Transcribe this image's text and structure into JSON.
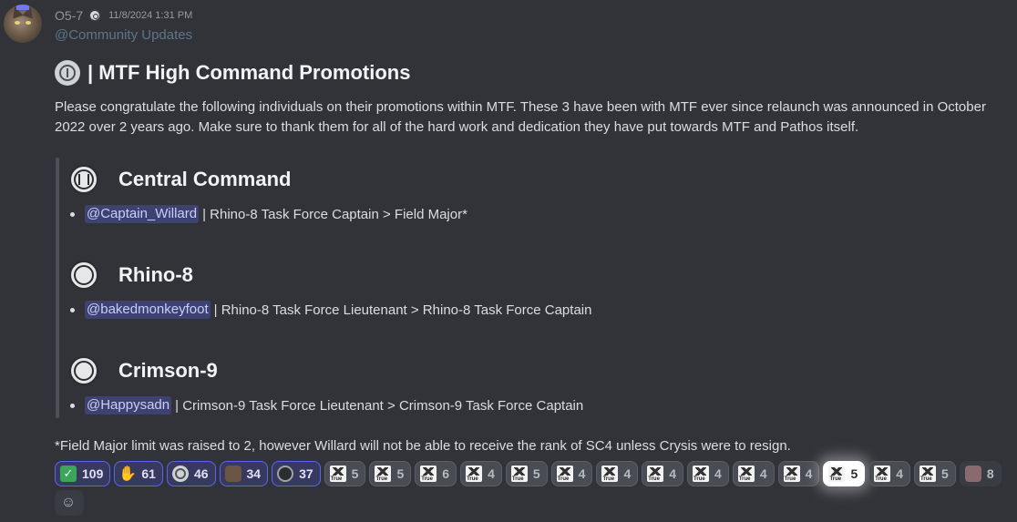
{
  "message": {
    "author": "O5-7",
    "timestamp": "11/8/2024 1:31 PM",
    "mention": "@Community Updates",
    "title": "| MTF High Command Promotions",
    "intro": "Please congratulate the following individuals on their promotions within MTF. These 3 have been with MTF ever since relaunch was announced in October 2022 over 2 years ago. Make sure to thank them for all of the hard work and dedication they have put towards MTF and Pathos itself.",
    "footnote": "*Field Major limit was raised to 2, however Willard will not be able to receive the rank of SC4 unless Crysis were to resign."
  },
  "sections": [
    {
      "title": "Central Command",
      "icon": "central-command-emblem-icon",
      "mention": "@Captain_Willard",
      "text": "| Rhino-8 Task Force Captain > Field Major*"
    },
    {
      "title": "Rhino-8",
      "icon": "rhino-8-emblem-icon",
      "mention": "@bakedmonkeyfoot",
      "text": "| Rhino-8 Task Force Lieutenant > Rhino-8 Task Force Captain"
    },
    {
      "title": "Crimson-9",
      "icon": "crimson-9-emblem-icon",
      "mention": "@Happysadn",
      "text": "| Crimson-9 Task Force Lieutenant > Crimson-9 Task Force Captain"
    }
  ],
  "reactions": [
    {
      "icon": "check-mark-icon",
      "count": "109",
      "style": "active"
    },
    {
      "icon": "clapping-hands-icon",
      "count": "61",
      "style": "active"
    },
    {
      "icon": "seal-icon",
      "count": "46",
      "style": "active"
    },
    {
      "icon": "dog-icon",
      "count": "34",
      "style": "active"
    },
    {
      "icon": "dark-seal-icon",
      "count": "37",
      "style": "active"
    },
    {
      "icon": "true-emote-icon",
      "count": "5",
      "style": "plain"
    },
    {
      "icon": "true-emote-icon",
      "count": "5",
      "style": "plain"
    },
    {
      "icon": "true-emote-icon",
      "count": "6",
      "style": "plain"
    },
    {
      "icon": "true-emote-icon",
      "count": "4",
      "style": "plain"
    },
    {
      "icon": "true-emote-icon",
      "count": "5",
      "style": "plain"
    },
    {
      "icon": "true-emote-icon",
      "count": "4",
      "style": "plain"
    },
    {
      "icon": "true-emote-icon",
      "count": "4",
      "style": "plain"
    },
    {
      "icon": "true-emote-icon",
      "count": "4",
      "style": "plain"
    },
    {
      "icon": "true-emote-icon",
      "count": "4",
      "style": "plain"
    },
    {
      "icon": "true-emote-icon",
      "count": "4",
      "style": "plain"
    },
    {
      "icon": "true-emote-icon",
      "count": "4",
      "style": "plain"
    },
    {
      "icon": "true-emote-icon",
      "count": "5",
      "style": "highlight"
    },
    {
      "icon": "true-emote-icon",
      "count": "4",
      "style": "plain"
    },
    {
      "icon": "true-emote-icon",
      "count": "5",
      "style": "plain"
    },
    {
      "icon": "eye-emote-icon",
      "count": "8",
      "style": "default"
    }
  ],
  "colors": {
    "background": "#323339",
    "mention_bg": "#3e4271",
    "mention_fg": "#c9cdfb",
    "accent": "#5865f2"
  }
}
